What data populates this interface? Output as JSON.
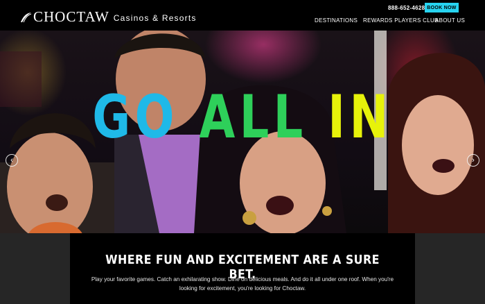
{
  "header": {
    "brand_name": "CHOCTAW",
    "brand_sub": "Casinos & Resorts",
    "phone": "888-652-4628",
    "book_label": "BOOK NOW",
    "nav": [
      "DESTINATIONS",
      "REWARDS PLAYERS CLUB",
      "ABOUT US"
    ]
  },
  "hero": {
    "headline_words": [
      "GO",
      "ALL",
      "IN"
    ],
    "headline_colors": [
      "#1fb9e8",
      "#2ed05a",
      "#e7f20a"
    ],
    "carousel": {
      "slides": 3,
      "active": 2
    },
    "icons": [
      "chevron-left-icon",
      "chevron-right-icon"
    ]
  },
  "intro": {
    "tagline": "WHERE FUN AND EXCITEMENT ARE A SURE BET.",
    "body": "Play your favorite games. Catch an exhilarating show. Dine on delicious meals. And do it all under one roof. When you're looking for excitement, you're looking for Choctaw."
  },
  "colors": {
    "accent": "#27d3f0",
    "header_bg": "#000000",
    "card_bg": "#000000"
  }
}
